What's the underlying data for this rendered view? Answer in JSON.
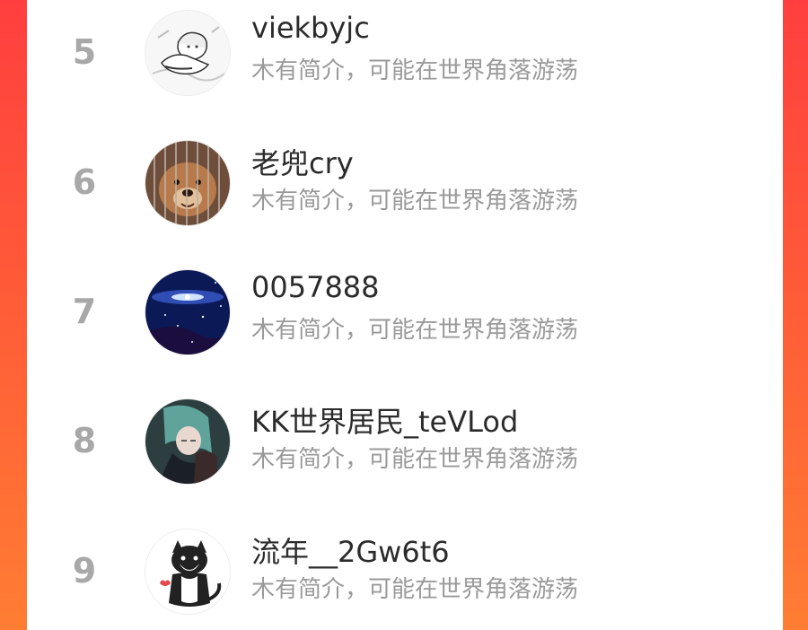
{
  "colors": {
    "panel_background": "#ffffff",
    "side_gradient_top": "#ff3f3f",
    "side_gradient_bottom": "#ff7d33",
    "rank_color": "#a8a8a8",
    "name_color": "#2b2b2b",
    "desc_color": "#9a9a9a"
  },
  "ranking": {
    "items": [
      {
        "rank": "5",
        "name": "viekbyjc",
        "desc": "木有简介，可能在世界角落游荡",
        "avatar_icon": "anime-girl-sketch-avatar"
      },
      {
        "rank": "6",
        "name": "老兜cry",
        "desc": "木有简介，可能在世界角落游荡",
        "avatar_icon": "dog-in-cage-avatar"
      },
      {
        "rank": "7",
        "name": "0057888",
        "desc": "木有简介，可能在世界角落游荡",
        "avatar_icon": "galaxy-avatar"
      },
      {
        "rank": "8",
        "name": "KK世界居民_teVLod",
        "desc": "木有简介，可能在世界角落游荡",
        "avatar_icon": "anime-hug-avatar"
      },
      {
        "rank": "9",
        "name": "流年__2Gw6t6",
        "desc": "木有简介，可能在世界角落游荡",
        "avatar_icon": "black-white-cat-avatar"
      }
    ]
  }
}
